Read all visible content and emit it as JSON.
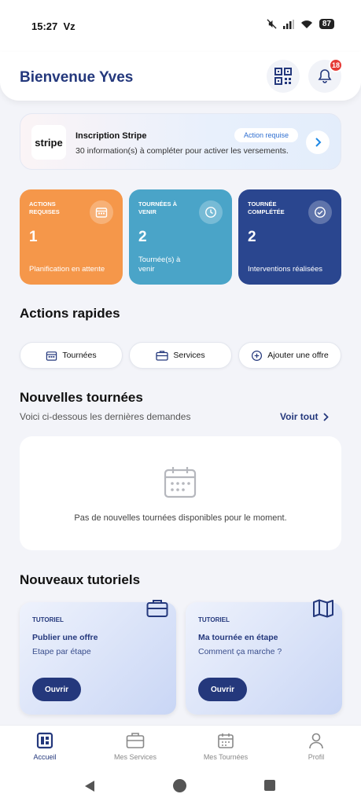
{
  "status_bar": {
    "time": "15:27",
    "carrier": "Vz",
    "battery": "87"
  },
  "header": {
    "greeting": "Bienvenue Yves",
    "notification_count": "18"
  },
  "stripe": {
    "logo_text": "stripe",
    "title": "Inscription Stripe",
    "description": "30 information(s) à compléter pour activer les versements.",
    "badge": "Action requise"
  },
  "stats": [
    {
      "label": "Actions requises",
      "value": "1",
      "sub": "Planification en attente",
      "color": "#f5974a",
      "icon": "calendar-icon"
    },
    {
      "label": "Tournées à venir",
      "value": "2",
      "sub": "Tournée(s) à venir",
      "color": "#4aa4c8",
      "icon": "clock-icon"
    },
    {
      "label": "Tournée complétée",
      "value": "2",
      "sub": "Interventions réalisées",
      "color": "#2a468f",
      "icon": "check-circle-icon"
    }
  ],
  "quick_actions": {
    "title": "Actions rapides",
    "items": [
      {
        "label": "Tournées",
        "icon": "calendar-icon"
      },
      {
        "label": "Services",
        "icon": "briefcase-icon"
      },
      {
        "label": "Ajouter une offre",
        "icon": "plus-circle-icon"
      }
    ]
  },
  "new_tours": {
    "title": "Nouvelles tournées",
    "subtitle": "Voici ci-dessous les dernières demandes",
    "see_all": "Voir tout",
    "empty_text": "Pas de nouvelles tournées disponibles pour le moment."
  },
  "tutorials": {
    "title": "Nouveaux tutoriels",
    "items": [
      {
        "tag": "TUTORIEL",
        "title": "Publier une offre",
        "desc": "Etape par étape",
        "button": "Ouvrir",
        "icon": "briefcase-icon"
      },
      {
        "tag": "TUTORIEL",
        "title": "Ma tournée en étape",
        "desc": "Comment ça marche ?",
        "button": "Ouvrir",
        "icon": "map-icon"
      }
    ]
  },
  "bottom_nav": [
    {
      "label": "Accueil",
      "active": true
    },
    {
      "label": "Mes Services",
      "active": false
    },
    {
      "label": "Mes Tournées",
      "active": false
    },
    {
      "label": "Profil",
      "active": false
    }
  ],
  "colors": {
    "primary": "#24387c",
    "orange": "#f5974a",
    "teal": "#4aa4c8",
    "navy": "#2a468f",
    "badge": "#e53935"
  }
}
